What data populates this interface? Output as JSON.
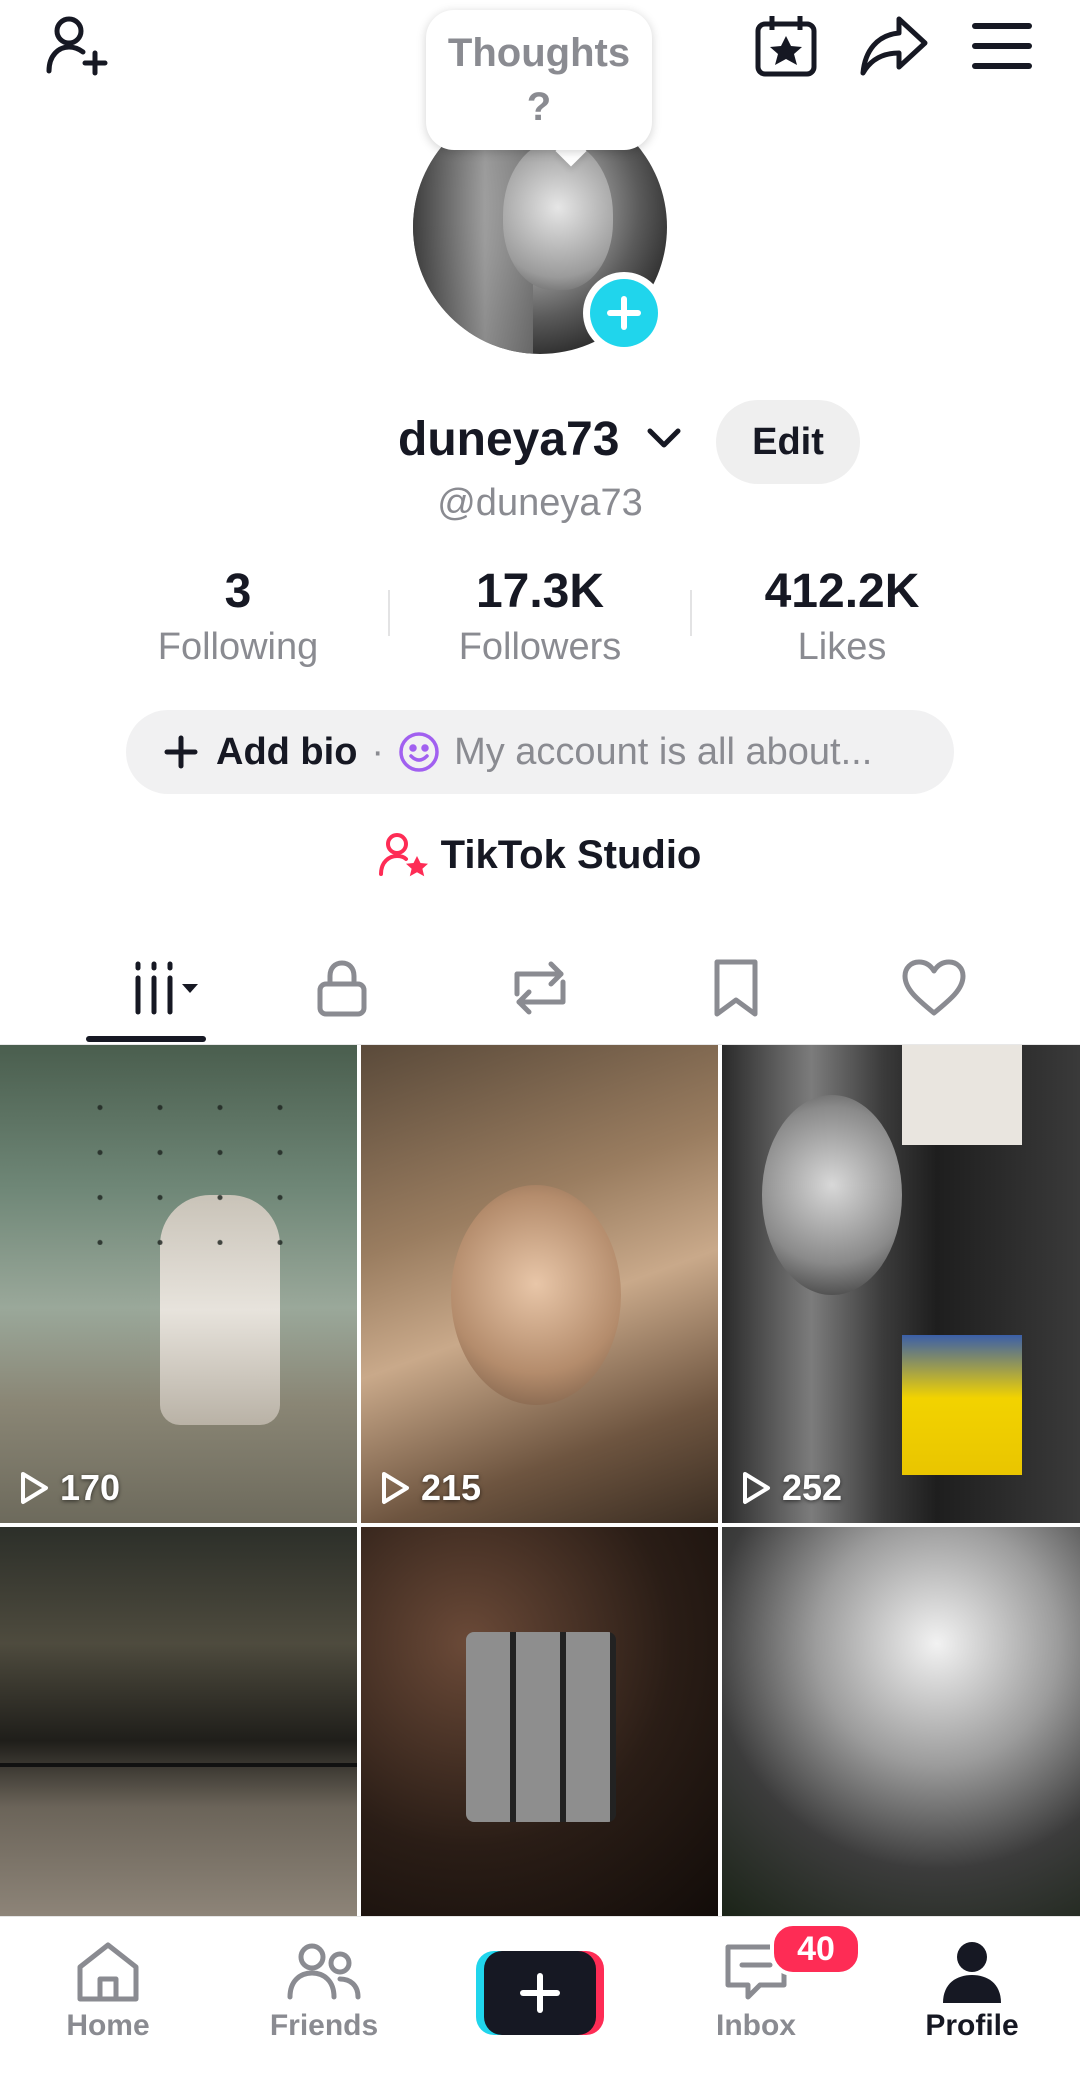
{
  "header": {
    "thoughts_bubble": "Thoughts\n?",
    "icons": [
      "add-friend-icon",
      "calendar-star-icon",
      "share-icon",
      "menu-icon"
    ]
  },
  "profile": {
    "display_name": "duneya73",
    "handle": "@duneya73",
    "edit_label": "Edit"
  },
  "stats": [
    {
      "value": "3",
      "label": "Following"
    },
    {
      "value": "17.3K",
      "label": "Followers"
    },
    {
      "value": "412.2K",
      "label": "Likes"
    }
  ],
  "bio": {
    "add_label": "Add bio",
    "separator": "·",
    "placeholder": "My account is all about..."
  },
  "studio": {
    "label": "TikTok Studio"
  },
  "tabs": [
    "videos-grid-icon",
    "lock-icon",
    "repost-icon",
    "bookmark-icon",
    "heart-icon"
  ],
  "videos": [
    {
      "views": "170"
    },
    {
      "views": "215"
    },
    {
      "views": "252"
    },
    {
      "views": ""
    },
    {
      "views": ""
    },
    {
      "views": ""
    }
  ],
  "nav": {
    "home": "Home",
    "friends": "Friends",
    "inbox": "Inbox",
    "inbox_badge": "40",
    "profile": "Profile"
  },
  "colors": {
    "accent_cyan": "#20d5ec",
    "accent_red": "#fe2c55",
    "text_primary": "#161823",
    "text_secondary": "#8a8b91"
  }
}
